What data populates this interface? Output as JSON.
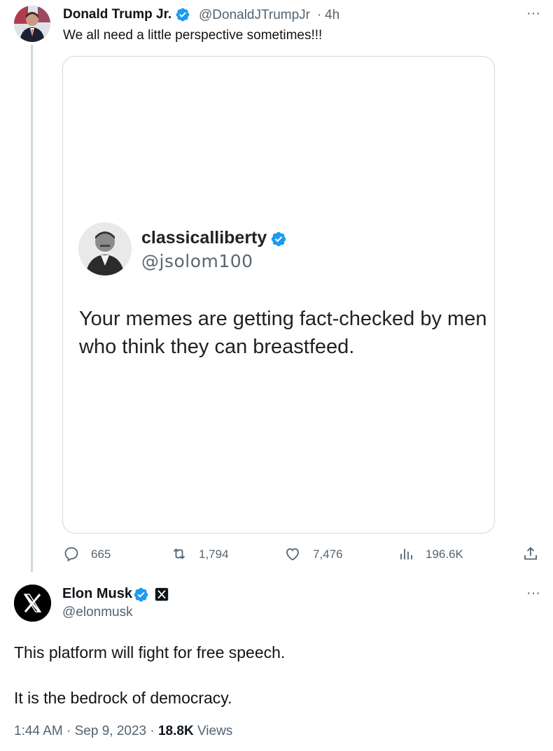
{
  "parent_tweet": {
    "author_name": "Donald Trump Jr.",
    "handle": "@DonaldJTrumpJr",
    "separator": "·",
    "time": "4h",
    "more": "···",
    "text": "We all need a little perspective sometimes!!!",
    "media": {
      "quoted_name": "classicalliberty",
      "quoted_handle": "@jsolom100",
      "quoted_text": "Your memes are getting fact-checked by men who think they can breastfeed."
    },
    "actions": {
      "replies": "665",
      "retweets": "1,794",
      "likes": "7,476",
      "views": "196.6K"
    }
  },
  "main_tweet": {
    "author_name": "Elon Musk",
    "handle": "@elonmusk",
    "more": "···",
    "line1": "This platform will fight for free speech.",
    "line2": "It is the bedrock of democracy.",
    "time": "1:44 AM",
    "date": "Sep 9, 2023",
    "views_count": "18.8K",
    "views_label": "Views",
    "separator": "·"
  },
  "colors": {
    "verified_blue": "#1d9bf0",
    "secondary_text": "#536471",
    "border": "#cfd9de"
  },
  "icons": [
    "verified-badge-icon",
    "reply-icon",
    "retweet-icon",
    "like-icon",
    "views-icon",
    "share-icon",
    "x-logo-icon",
    "more-icon"
  ]
}
